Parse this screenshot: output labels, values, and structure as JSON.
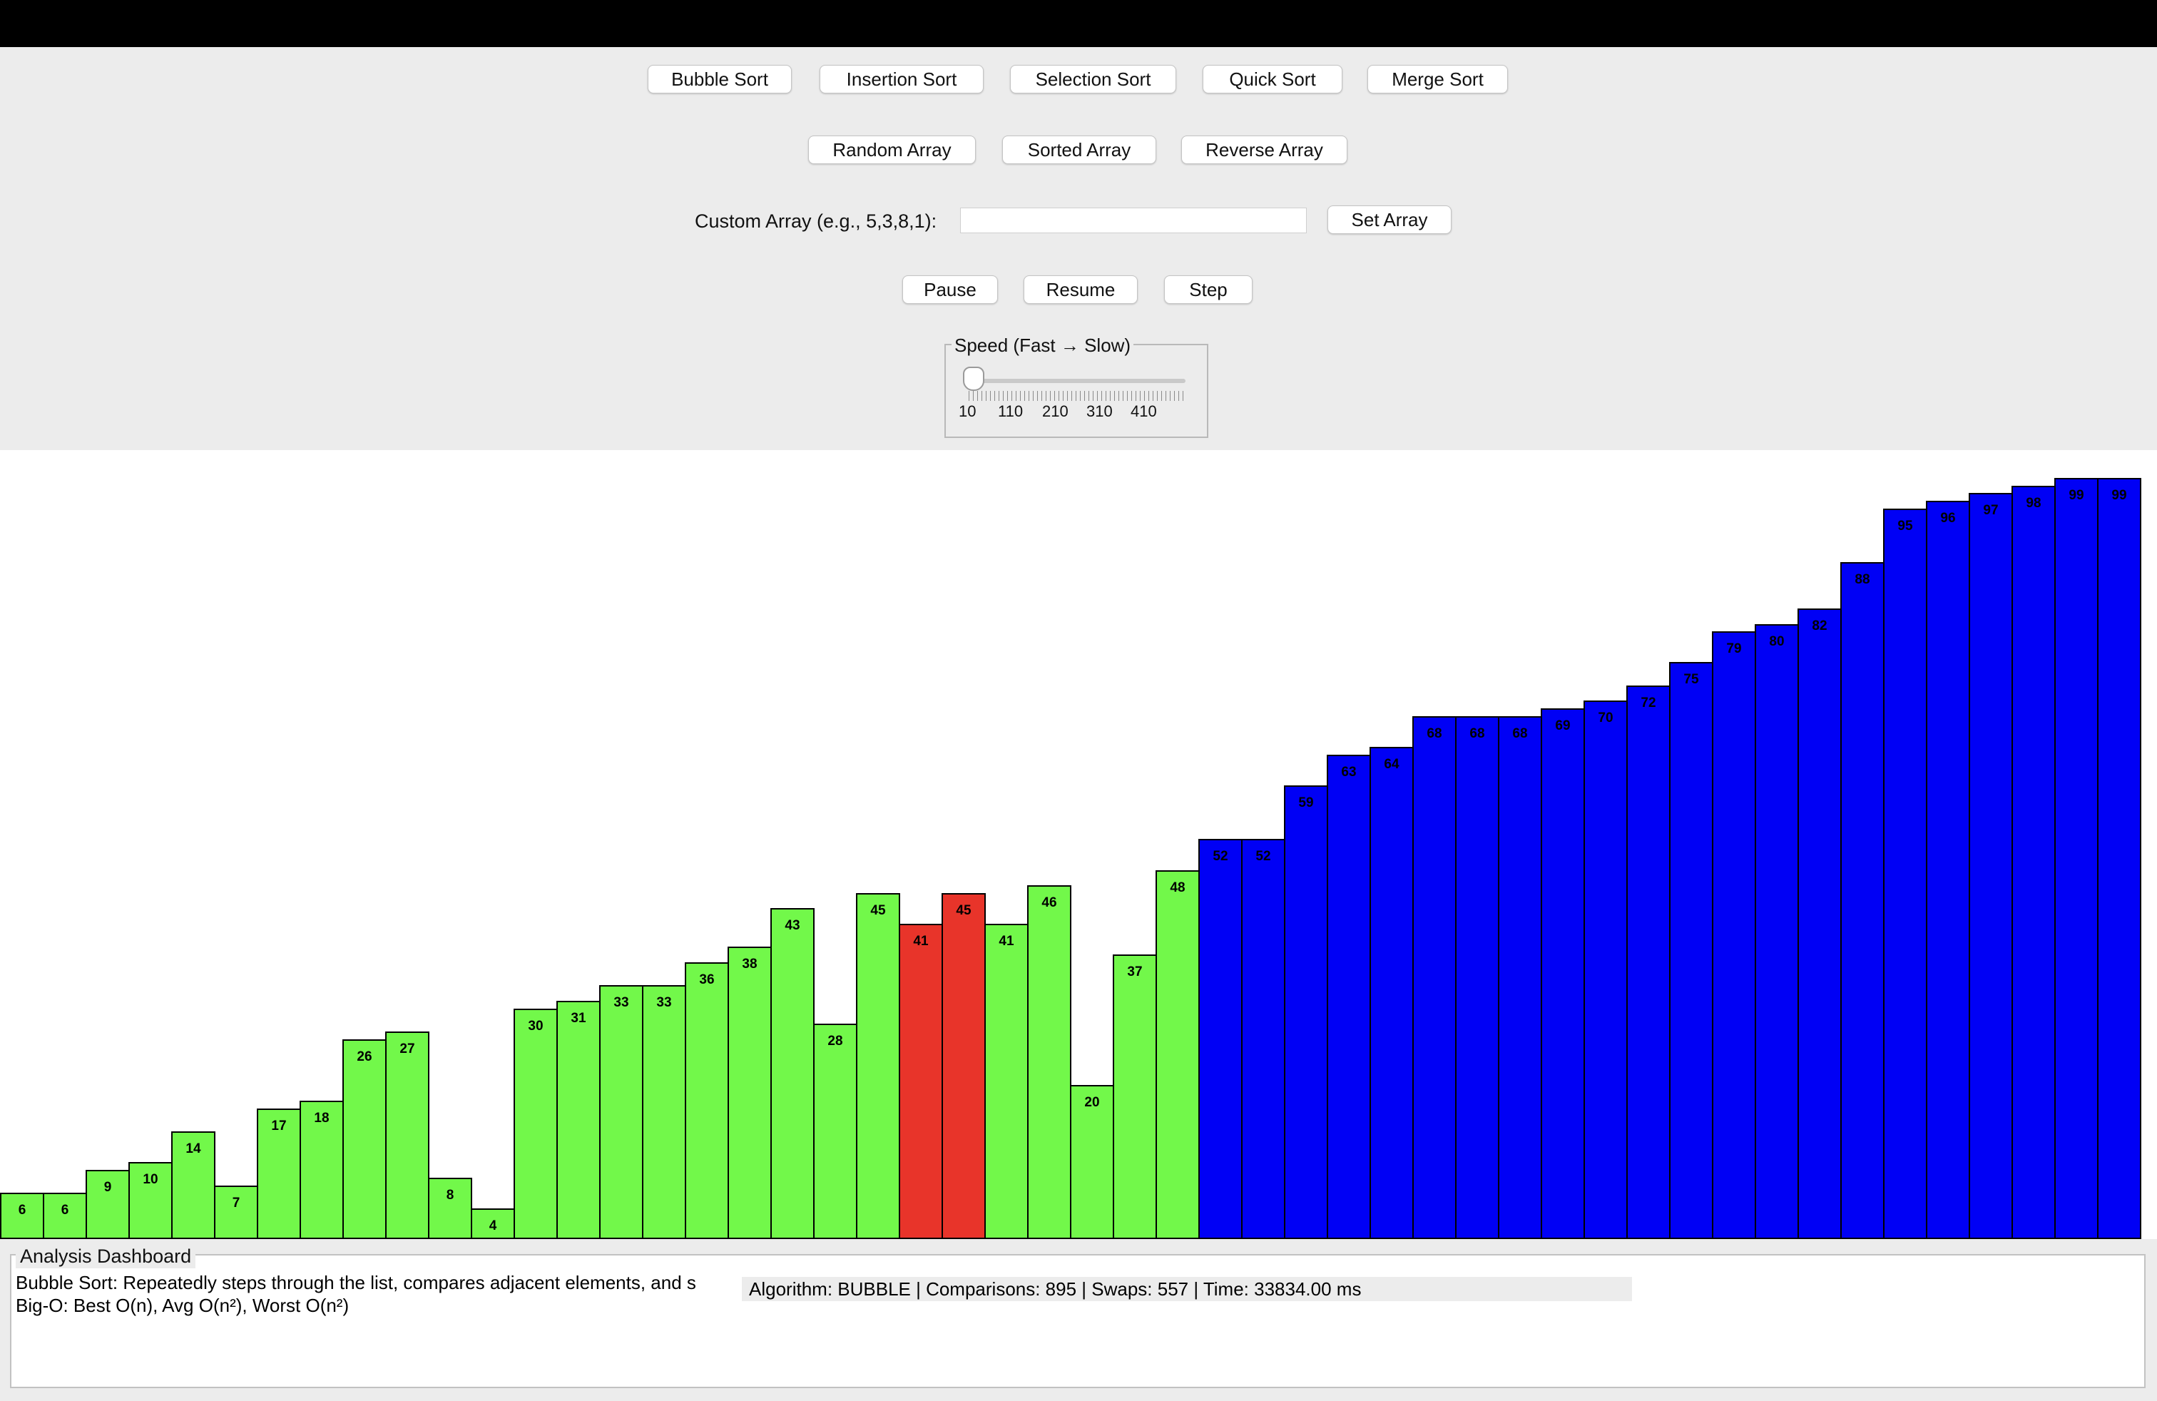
{
  "algorithm_buttons": [
    "Bubble Sort",
    "Insertion Sort",
    "Selection Sort",
    "Quick Sort",
    "Merge Sort"
  ],
  "array_buttons": [
    "Random Array",
    "Sorted Array",
    "Reverse Array"
  ],
  "custom_array": {
    "label": "Custom Array (e.g., 5,3,8,1):",
    "value": "",
    "set_label": "Set Array"
  },
  "playback_buttons": [
    "Pause",
    "Resume",
    "Step"
  ],
  "speed": {
    "legend": "Speed (Fast → Slow)",
    "value": 10,
    "min": 10,
    "tick_labels": [
      "10",
      "110",
      "210",
      "310",
      "410"
    ]
  },
  "colors": {
    "unsorted": "#72f84a",
    "comparing": "#e8342a",
    "sorted": "#0000f5"
  },
  "array": {
    "values": [
      6,
      6,
      9,
      10,
      14,
      7,
      17,
      18,
      26,
      27,
      8,
      4,
      30,
      31,
      33,
      33,
      36,
      38,
      43,
      28,
      45,
      41,
      45,
      41,
      46,
      20,
      37,
      48,
      52,
      52,
      59,
      63,
      64,
      68,
      68,
      68,
      69,
      70,
      72,
      75,
      79,
      80,
      82,
      88,
      95,
      96,
      97,
      98,
      99,
      99
    ],
    "comparing_indices": [
      21,
      22
    ],
    "sorted_from_index": 28
  },
  "dashboard": {
    "title": "Analysis Dashboard",
    "description": "Bubble Sort: Repeatedly steps through the list, compares adjacent elements, and s",
    "complexity": "Big-O: Best O(n), Avg O(n²), Worst O(n²)",
    "stats": "Algorithm: BUBBLE | Comparisons: 895 | Swaps: 557 | Time: 33834.00 ms"
  }
}
